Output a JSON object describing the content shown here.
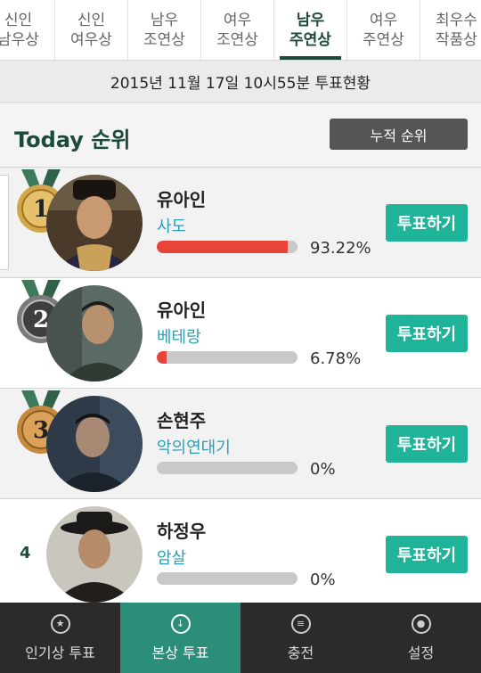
{
  "tabs": [
    {
      "line1": "신인",
      "line2": "남우상"
    },
    {
      "line1": "신인",
      "line2": "여우상"
    },
    {
      "line1": "남우",
      "line2": "조연상"
    },
    {
      "line1": "여우",
      "line2": "조연상"
    },
    {
      "line1": "남우",
      "line2": "주연상"
    },
    {
      "line1": "여우",
      "line2": "주연상"
    },
    {
      "line1": "최우수",
      "line2": "작품상"
    }
  ],
  "date_status": "2015년 11월 17일 10시55분 투표현황",
  "header": {
    "title": "Today 순위",
    "cumulative_button": "누적 순위"
  },
  "ranks": [
    {
      "rank": "1",
      "name": "유아인",
      "movie": "사도",
      "percent": "93.22%",
      "fill_percent": 93.22,
      "vote_label": "투표하기"
    },
    {
      "rank": "2",
      "name": "유아인",
      "movie": "베테랑",
      "percent": "6.78%",
      "fill_percent": 6.78,
      "vote_label": "투표하기"
    },
    {
      "rank": "3",
      "name": "손현주",
      "movie": "악의연대기",
      "percent": "0%",
      "fill_percent": 0,
      "vote_label": "투표하기"
    },
    {
      "rank": "4",
      "name": "하정우",
      "movie": "암살",
      "percent": "0%",
      "fill_percent": 0,
      "vote_label": "투표하기"
    }
  ],
  "bottom_nav": [
    {
      "label": "인기상 투표",
      "icon": "star-icon"
    },
    {
      "label": "본상 투표",
      "icon": "download-icon"
    },
    {
      "label": "충전",
      "icon": "coin-icon"
    },
    {
      "label": "설정",
      "icon": "settings-icon"
    }
  ],
  "colors": {
    "accent": "#1e4a3c",
    "vote_button": "#1fb49a",
    "movie_text": "#2b9fb3",
    "bar_fill": "#e8443a",
    "nav_active": "#2a8e78",
    "gold_medal": "#c89a3c",
    "silver_medal": "#8a8a8a"
  }
}
